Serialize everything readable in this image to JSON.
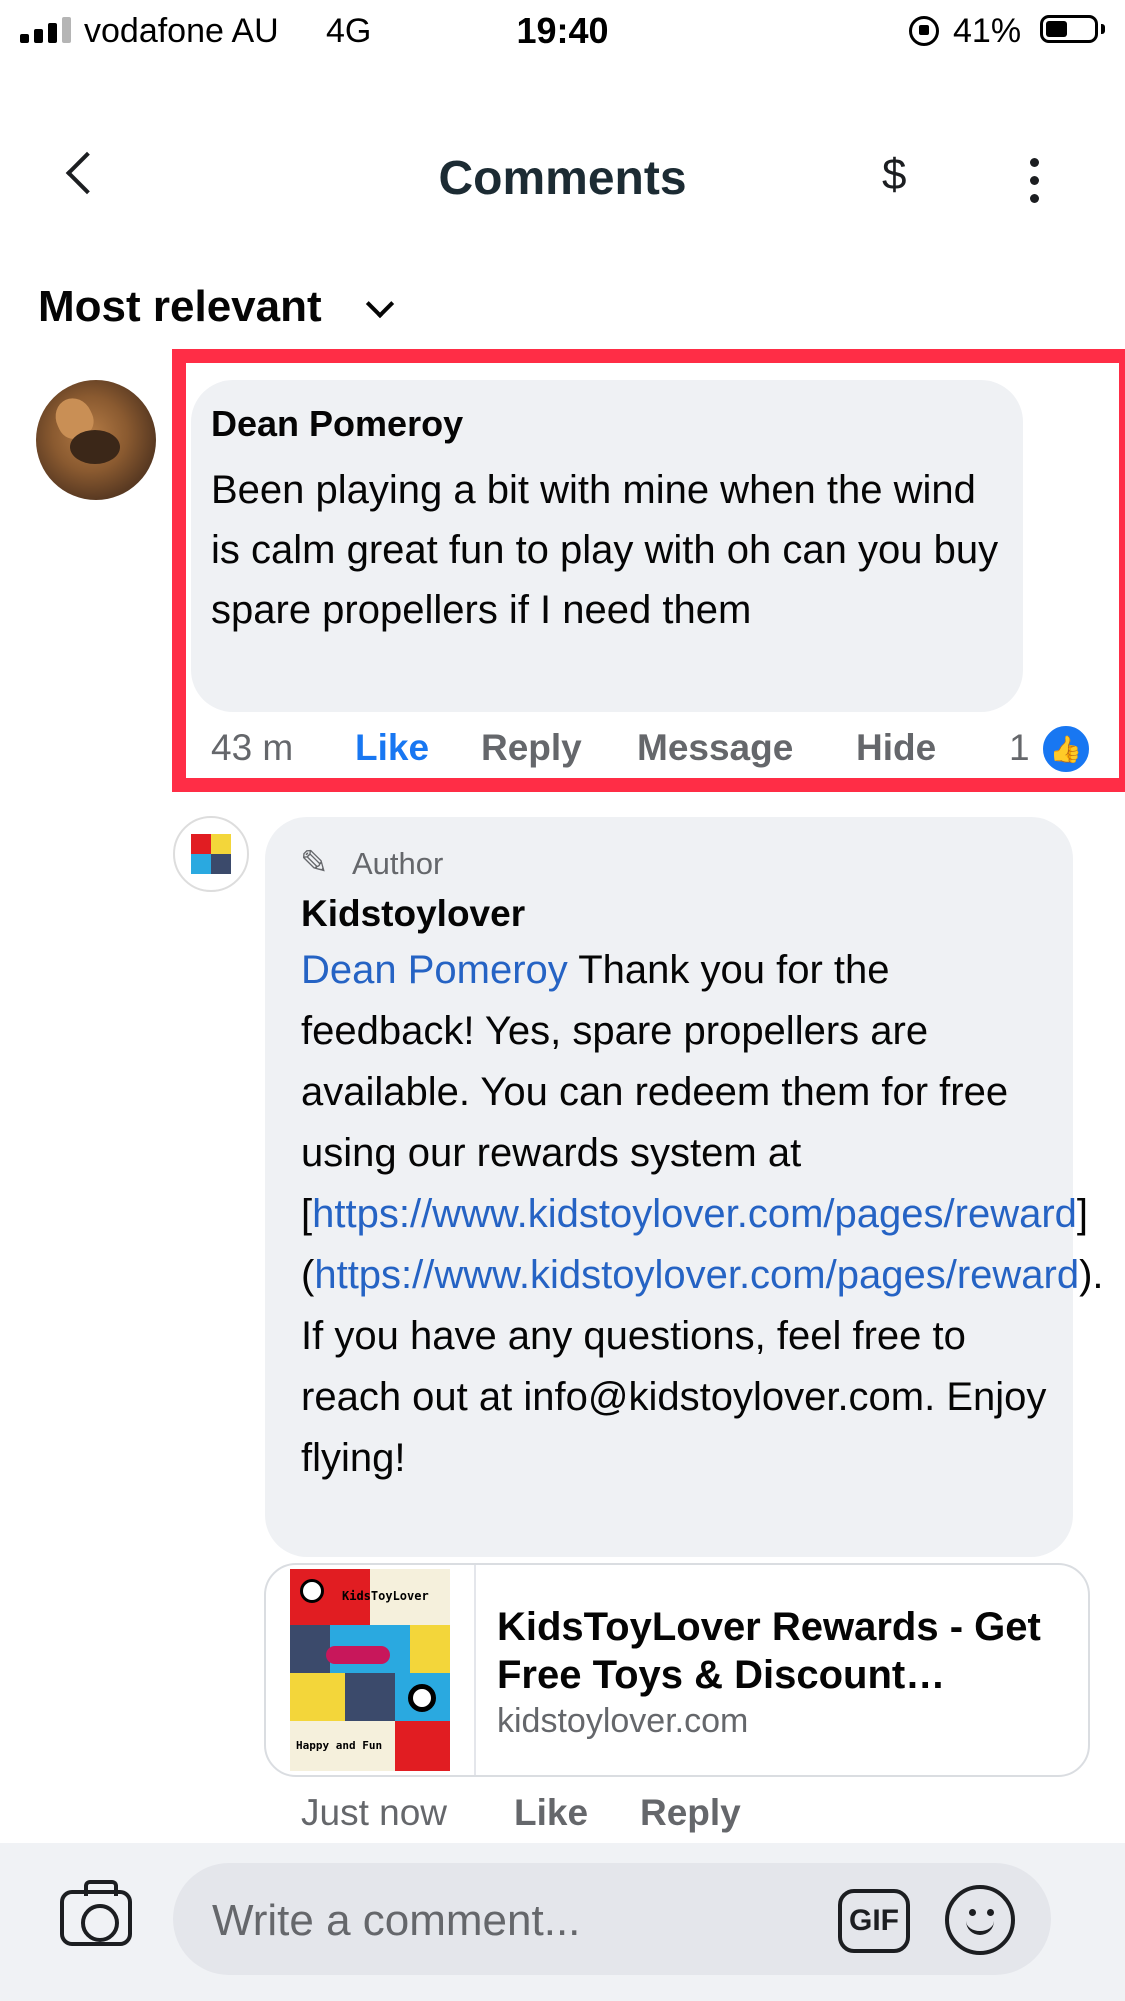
{
  "status_bar": {
    "carrier": "vodafone AU",
    "network": "4G",
    "time": "19:40",
    "battery": "41%"
  },
  "header": {
    "title": "Comments",
    "dollar_icon": "$"
  },
  "sort": {
    "label": "Most relevant"
  },
  "comment": {
    "author": "Dean Pomeroy",
    "text": "Been playing a bit with mine when the wind is calm great fun to play with oh can you buy spare propellers if I need them",
    "time": "43 m",
    "actions": {
      "like": "Like",
      "reply": "Reply",
      "message": "Message",
      "hide": "Hide"
    },
    "reaction_count": "1"
  },
  "reply": {
    "badge": "Author",
    "author": "Kidstoylover",
    "mention": "Dean Pomeroy",
    "text_1": " Thank you for the feedback! Yes, spare propellers are available. You can redeem them for free using our rewards system at [",
    "link_1": "https://www.kidstoylover.com/pages/reward",
    "text_2": "](",
    "link_2": "https://www.kidstoylover.com/pages/reward",
    "text_3": "). If you have any questions, feel free to reach out at info@kidstoylover.com. Enjoy flying!",
    "time": "Just now",
    "actions": {
      "like": "Like",
      "reply": "Reply"
    }
  },
  "link_preview": {
    "title": "KidsToyLover Rewards - Get Free Toys & Discount…",
    "domain": "kidstoylover.com",
    "thumb_logo_text": "KidsToyLover",
    "thumb_tagline": "Happy and Fun"
  },
  "composer": {
    "placeholder": "Write a comment...",
    "gif_label": "GIF"
  },
  "colors": {
    "accent": "#1877f2",
    "highlight": "#ff2d46",
    "bubble": "#eff1f4"
  }
}
